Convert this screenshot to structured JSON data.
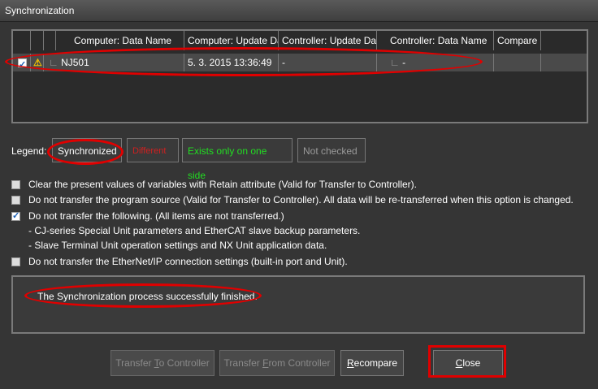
{
  "window": {
    "title": "Synchronization"
  },
  "grid": {
    "columns": [
      "Computer: Data Name",
      "Computer: Update Da",
      "Controller: Update Da",
      "Controller: Data Name",
      "Compare"
    ],
    "rows": [
      {
        "checked": true,
        "warning": true,
        "computer_name": "NJ501",
        "computer_update": "5. 3. 2015 13:36:49",
        "controller_update": "-",
        "controller_name": "-",
        "compare": ""
      }
    ]
  },
  "legend": {
    "label": "Legend:",
    "items": [
      {
        "label": "Synchronized",
        "color": "#ffffff"
      },
      {
        "label": "Different",
        "color": "#d02020"
      },
      {
        "label": "Exists only on one side",
        "color": "#22dd22"
      },
      {
        "label": "Not checked",
        "color": "#9a9a9a"
      }
    ]
  },
  "options": [
    {
      "checked": false,
      "label": "Clear the present values of variables with Retain attribute (Valid for Transfer to Controller)."
    },
    {
      "checked": false,
      "label": "Do not transfer the program source (Valid for Transfer to Controller). All data will be re-transferred when this option is changed."
    },
    {
      "checked": true,
      "label": "Do not transfer the following. (All items are not transferred.)",
      "sub_items": [
        "- CJ-series Special Unit parameters and EtherCAT slave backup parameters.",
        "- Slave Terminal Unit operation settings and NX Unit application data."
      ]
    },
    {
      "checked": false,
      "label": "Do not transfer the EtherNet/IP connection settings (built-in port and Unit)."
    }
  ],
  "status": {
    "message": "The Synchronization process successfully finished."
  },
  "buttons": {
    "transfer_to_prefix": "Transfer ",
    "transfer_to_key": "T",
    "transfer_to_suffix": "o Controller",
    "transfer_from_prefix": "Transfer ",
    "transfer_from_key": "F",
    "transfer_from_suffix": "rom Controller",
    "recompare_key": "R",
    "recompare_suffix": "ecompare",
    "close_key": "C",
    "close_suffix": "lose"
  },
  "annotation_color": "#e00000"
}
